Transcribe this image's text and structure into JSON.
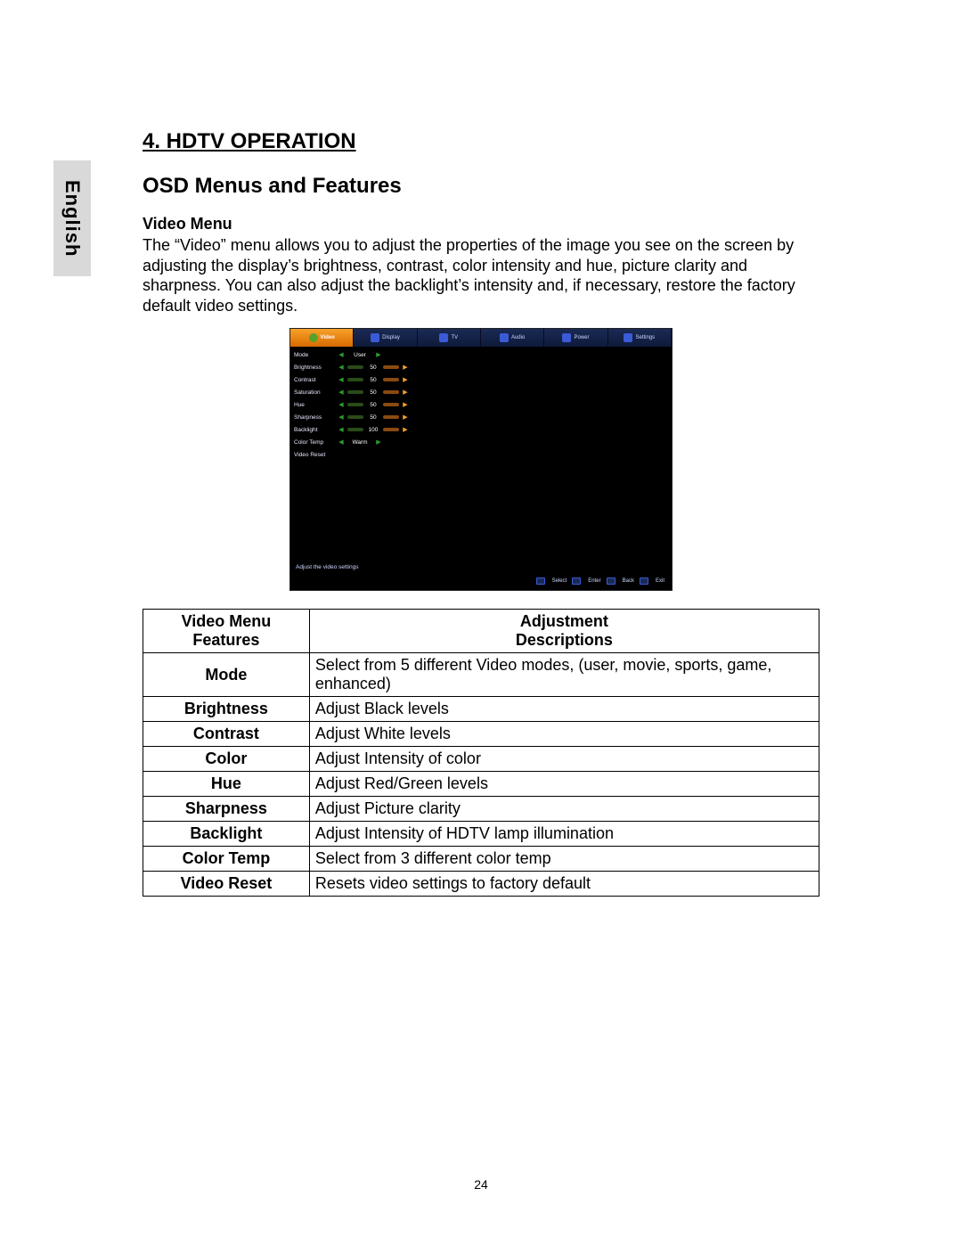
{
  "lang_tab": "English",
  "section_title": "4.    HDTV OPERATION",
  "sub_title": "OSD Menus and Features",
  "video_menu_label": "Video Menu",
  "body_text": "The “Video” menu allows you to adjust the properties of the image you see on the screen by adjusting the display’s brightness, contrast, color intensity and hue, picture clarity and sharpness. You can also adjust the backlight’s intensity and, if necessary, restore the factory default video settings.",
  "osd": {
    "tabs": [
      "Video",
      "Display",
      "TV",
      "Audio",
      "Power",
      "Settings"
    ],
    "rows": [
      {
        "label": "Mode",
        "type": "select",
        "value": "User"
      },
      {
        "label": "Brightness",
        "type": "slider",
        "value": "50"
      },
      {
        "label": "Contrast",
        "type": "slider",
        "value": "50"
      },
      {
        "label": "Saturation",
        "type": "slider",
        "value": "50"
      },
      {
        "label": "Hue",
        "type": "slider",
        "value": "50"
      },
      {
        "label": "Sharpness",
        "type": "slider",
        "value": "50"
      },
      {
        "label": "Backlight",
        "type": "slider",
        "value": "100"
      },
      {
        "label": "Color Temp",
        "type": "select",
        "value": "Warm"
      },
      {
        "label": "Video Reset",
        "type": "none",
        "value": ""
      }
    ],
    "hint": "Adjust the video settings",
    "footer": [
      "Select",
      "Enter",
      "Back",
      "Exit"
    ]
  },
  "table": {
    "header_left": "Video Menu Features",
    "header_right_line1": "Adjustment",
    "header_right_line2": "Descriptions",
    "rows": [
      {
        "feature": "Mode",
        "desc": "Select from  5 different Video modes, (user, movie, sports, game, enhanced)"
      },
      {
        "feature": "Brightness",
        "desc": "Adjust Black levels"
      },
      {
        "feature": "Contrast",
        "desc": "Adjust White levels"
      },
      {
        "feature": "Color",
        "desc": "Adjust Intensity of color"
      },
      {
        "feature": "Hue",
        "desc": "Adjust Red/Green levels"
      },
      {
        "feature": "Sharpness",
        "desc": "Adjust Picture clarity"
      },
      {
        "feature": "Backlight",
        "desc": "Adjust Intensity of HDTV lamp illumination"
      },
      {
        "feature": "Color Temp",
        "desc": "Select from 3 different color temp"
      },
      {
        "feature": "Video Reset",
        "desc": "Resets video settings to factory default"
      }
    ]
  },
  "page_number": "24"
}
